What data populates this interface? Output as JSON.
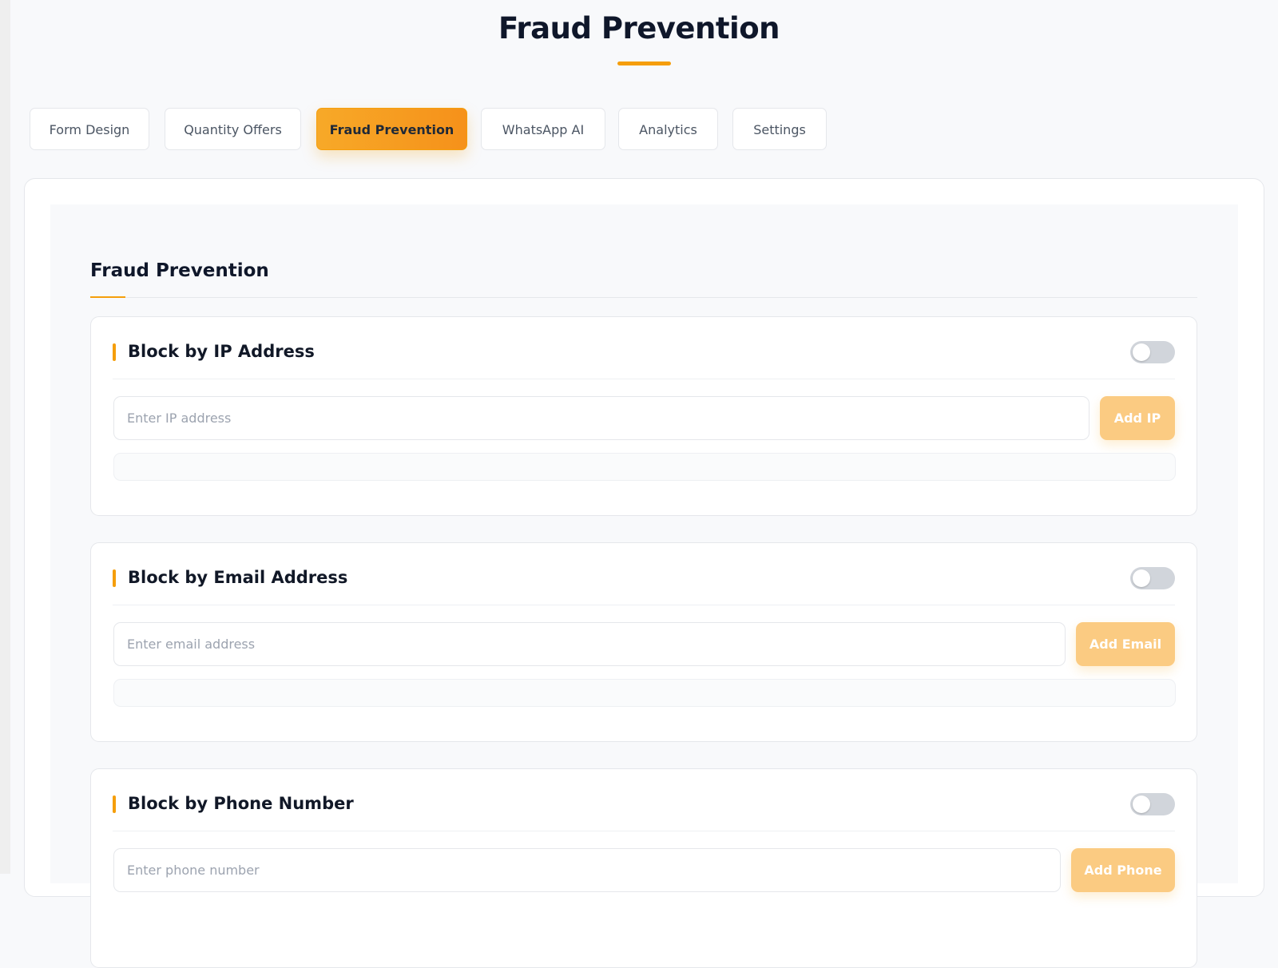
{
  "page": {
    "title": "Fraud Prevention"
  },
  "tabs": [
    {
      "label": "Form Design",
      "active": false
    },
    {
      "label": "Quantity Offers",
      "active": false
    },
    {
      "label": "Fraud Prevention",
      "active": true
    },
    {
      "label": "WhatsApp AI",
      "active": false
    },
    {
      "label": "Analytics",
      "active": false
    },
    {
      "label": "Settings",
      "active": false
    }
  ],
  "section": {
    "title": "Fraud Prevention"
  },
  "blocks": [
    {
      "title": "Block by IP Address",
      "enabled": false,
      "placeholder": "Enter IP address",
      "value": "",
      "button": "Add IP"
    },
    {
      "title": "Block by Email Address",
      "enabled": false,
      "placeholder": "Enter email address",
      "value": "",
      "button": "Add Email"
    },
    {
      "title": "Block by Phone Number",
      "enabled": false,
      "placeholder": "Enter phone number",
      "value": "",
      "button": "Add Phone"
    }
  ],
  "colors": {
    "accent": "#f59e0b",
    "button_disabled": "#fbcb82",
    "toggle_off": "#d1d5db"
  }
}
